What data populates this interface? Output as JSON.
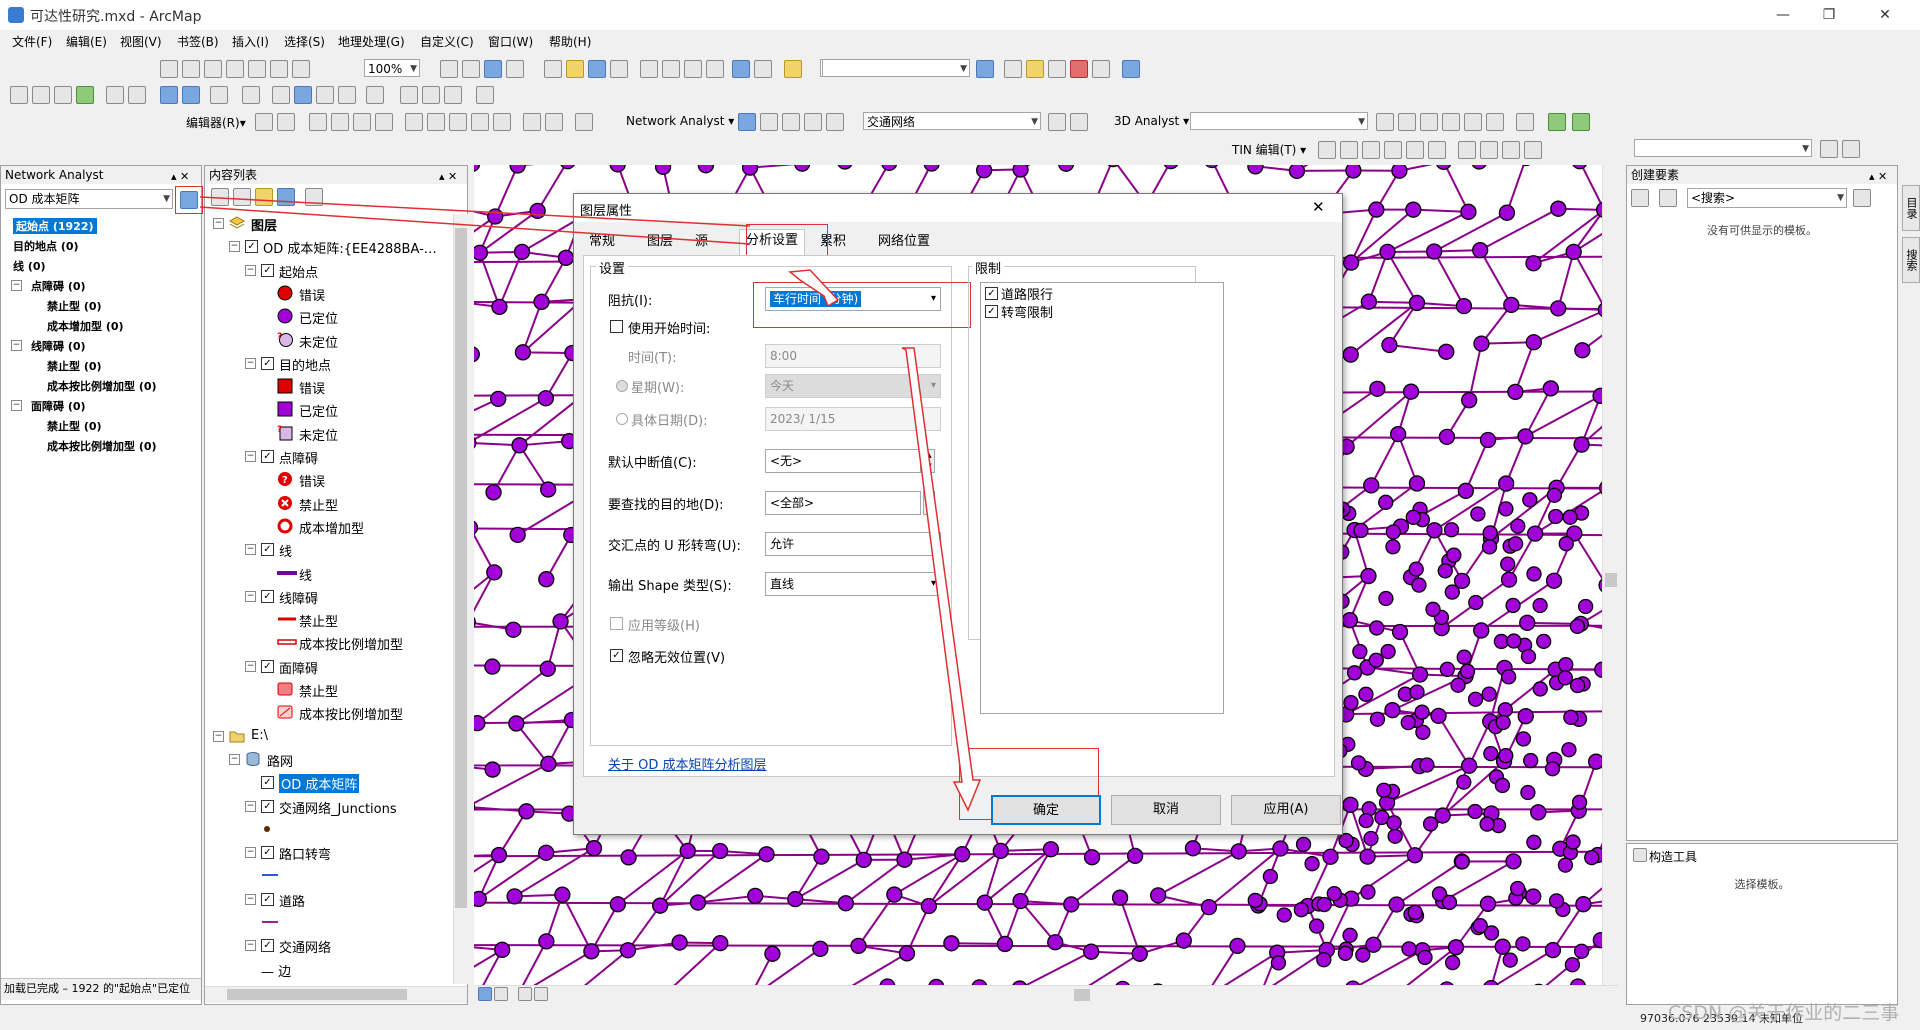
{
  "window": {
    "title": "可达性研究.mxd - ArcMap",
    "minimize": "—",
    "maximize": "❐",
    "close": "✕"
  },
  "menu": [
    "文件(F)",
    "编辑(E)",
    "视图(V)",
    "书签(B)",
    "插入(I)",
    "选择(S)",
    "地理处理(G)",
    "自定义(C)",
    "窗口(W)",
    "帮助(H)"
  ],
  "toolbar": {
    "zoom_value": "100%",
    "editor_label": "编辑器(R)▾",
    "network_analyst_label": "Network Analyst ▾",
    "network_dataset": "交通网络",
    "analyst3d_label": "3D Analyst ▾",
    "tin_label": "TIN 编辑(T) ▾"
  },
  "na_window": {
    "title": "Network Analyst",
    "pin": "▴ ✕",
    "layer_select": "OD 成本矩阵",
    "items": [
      {
        "text": "起始点 (1922)",
        "level": 1,
        "bold": true,
        "selected": true,
        "expander": ""
      },
      {
        "text": "目的地点 (0)",
        "level": 1,
        "bold": true,
        "expander": ""
      },
      {
        "text": "线 (0)",
        "level": 1,
        "bold": true,
        "expander": ""
      },
      {
        "text": "点障碍 (0)",
        "level": 0,
        "bold": true,
        "expander": "−"
      },
      {
        "text": "禁止型 (0)",
        "level": 2,
        "bold": true,
        "expander": ""
      },
      {
        "text": "成本增加型 (0)",
        "level": 2,
        "bold": true,
        "expander": ""
      },
      {
        "text": "线障碍 (0)",
        "level": 0,
        "bold": true,
        "expander": "−"
      },
      {
        "text": "禁止型 (0)",
        "level": 2,
        "bold": true,
        "expander": ""
      },
      {
        "text": "成本按比例增加型 (0)",
        "level": 2,
        "bold": true,
        "expander": ""
      },
      {
        "text": "面障碍 (0)",
        "level": 0,
        "bold": true,
        "expander": "−"
      },
      {
        "text": "禁止型 (0)",
        "level": 2,
        "bold": true,
        "expander": ""
      },
      {
        "text": "成本按比例增加型 (0)",
        "level": 2,
        "bold": true,
        "expander": ""
      }
    ],
    "status": "加载已完成 – 1922 的\"起始点\"已定位"
  },
  "toc": {
    "title": "内容列表",
    "pin": "▴ ✕",
    "items": [
      {
        "text": "图层",
        "indent": 8,
        "expander": "−",
        "check": false,
        "symbol": "layers",
        "bold": true
      },
      {
        "text": "OD 成本矩阵:{EE4288BA-…",
        "indent": 24,
        "expander": "−",
        "check": true
      },
      {
        "text": "起始点",
        "indent": 40,
        "expander": "−",
        "check": true
      },
      {
        "text": "错误",
        "indent": 72,
        "symbol": "circle-red"
      },
      {
        "text": "已定位",
        "indent": 72,
        "symbol": "circle-purple"
      },
      {
        "text": "未定位",
        "indent": 72,
        "symbol": "circle-unloc"
      },
      {
        "text": "目的地点",
        "indent": 40,
        "expander": "−",
        "check": true
      },
      {
        "text": "错误",
        "indent": 72,
        "symbol": "square-red"
      },
      {
        "text": "已定位",
        "indent": 72,
        "symbol": "square-purple"
      },
      {
        "text": "未定位",
        "indent": 72,
        "symbol": "square-unloc"
      },
      {
        "text": "点障碍",
        "indent": 40,
        "expander": "−",
        "check": true
      },
      {
        "text": "错误",
        "indent": 72,
        "symbol": "err-circle"
      },
      {
        "text": "禁止型",
        "indent": 72,
        "symbol": "x-circle"
      },
      {
        "text": "成本增加型",
        "indent": 72,
        "symbol": "ring-red"
      },
      {
        "text": "线",
        "indent": 40,
        "expander": "−",
        "check": true
      },
      {
        "text": "线",
        "indent": 72,
        "symbol": "line-purple"
      },
      {
        "text": "线障碍",
        "indent": 40,
        "expander": "−",
        "check": true
      },
      {
        "text": "禁止型",
        "indent": 72,
        "symbol": "line-red"
      },
      {
        "text": "成本按比例增加型",
        "indent": 72,
        "symbol": "line-red-hollow"
      },
      {
        "text": "面障碍",
        "indent": 40,
        "expander": "−",
        "check": true
      },
      {
        "text": "禁止型",
        "indent": 72,
        "symbol": "poly-red"
      },
      {
        "text": "成本按比例增加型",
        "indent": 72,
        "symbol": "poly-red-hatch"
      },
      {
        "text": "E:\\",
        "indent": 8,
        "expander": "−",
        "symbol": "folder"
      },
      {
        "text": "路网",
        "indent": 24,
        "expander": "−",
        "symbol": "db"
      },
      {
        "text": "OD 成本矩阵",
        "indent": 56,
        "check": true,
        "selected": true
      },
      {
        "text": "交通网络_Junctions",
        "indent": 40,
        "expander": "−",
        "check": true
      },
      {
        "text": "",
        "indent": 56,
        "symbol": "dot-small"
      },
      {
        "text": "路口转弯",
        "indent": 40,
        "expander": "−",
        "check": true
      },
      {
        "text": "",
        "indent": 56,
        "symbol": "line-blue"
      },
      {
        "text": "道路",
        "indent": 40,
        "expander": "−",
        "check": true
      },
      {
        "text": "",
        "indent": 56,
        "symbol": "line-magenta"
      },
      {
        "text": "交通网络",
        "indent": 40,
        "expander": "−",
        "check": true
      },
      {
        "text": "— 边",
        "indent": 56
      }
    ]
  },
  "dialog": {
    "title": "图层属性",
    "close": "✕",
    "tabs": [
      "常规",
      "图层",
      "源",
      "分析设置",
      "累积",
      "网络位置"
    ],
    "active_tab": "分析设置",
    "settings_group": "设置",
    "impedance_label": "阻抗(I):",
    "impedance_value": "车行时间 (分钟)",
    "use_start_time_label": "使用开始时间:",
    "use_start_time_checked": false,
    "time_label": "时间(T):",
    "time_value": "8:00",
    "weekday_label": "星期(W):",
    "weekday_value": "今天",
    "date_label": "具体日期(D):",
    "date_value": "2023/  1/15",
    "default_cutoff_label": "默认中断值(C):",
    "default_cutoff_value": "<无>",
    "destinations_label": "要查找的目的地(D):",
    "destinations_value": "<全部>",
    "uturn_label": "交汇点的 U 形转弯(U):",
    "uturn_value": "允许",
    "shape_label": "输出 Shape 类型(S):",
    "shape_value": "直线",
    "hierarchy_label": "应用等级(H)",
    "hierarchy_checked": false,
    "ignore_invalid_label": "忽略无效位置(V)",
    "ignore_invalid_checked": true,
    "restrictions_group": "限制",
    "restrictions": [
      {
        "label": "道路限行",
        "checked": true
      },
      {
        "label": "转弯限制",
        "checked": true
      }
    ],
    "about_link": "关于 OD 成本矩阵分析图层",
    "ok": "确定",
    "cancel": "取消",
    "apply": "应用(A)"
  },
  "create_features": {
    "title": "创建要素",
    "search": "<搜索>",
    "empty": "没有可供显示的模板。",
    "construct_title": "构造工具",
    "construct_empty": "选择模板。"
  },
  "right_side_tabs": [
    "目录",
    "搜索"
  ],
  "status": {
    "coords": "97036.076  23539.14 未知单位",
    "watermark": "CSDN @关于作业的二三事"
  },
  "colors": {
    "node_fill": "#a200d8",
    "road": "#8a008a",
    "highlight_red": "#e03030",
    "selection": "#0078d7"
  }
}
